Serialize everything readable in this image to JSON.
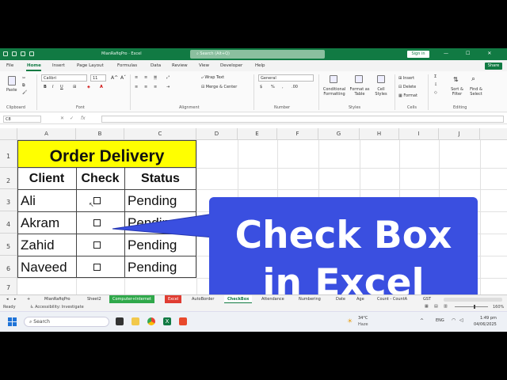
{
  "title_bar": {
    "doc_title": "MianRafiqPro  ·  Excel",
    "search_placeholder": "Search (Alt+Q)",
    "sign_in": "Sign in"
  },
  "menu": [
    "File",
    "Home",
    "Insert",
    "Page Layout",
    "Formulas",
    "Data",
    "Review",
    "View",
    "Developer",
    "Help"
  ],
  "share": "Share",
  "ribbon": {
    "paste": "Paste",
    "font_name": "Calibri",
    "font_size": "11",
    "wrap_text": "Wrap Text",
    "merge_center": "Merge & Center",
    "number_format": "General",
    "conditional_formatting": "Conditional Formatting",
    "format_as_table": "Format as Table",
    "cell_styles": "Cell Styles",
    "insert": "Insert",
    "delete": "Delete",
    "format": "Format",
    "sort_filter": "Sort & Filter",
    "find_select": "Find & Select",
    "groups": {
      "clipboard": "Clipboard",
      "font": "Font",
      "alignment": "Alignment",
      "number": "Number",
      "styles": "Styles",
      "cells": "Cells",
      "editing": "Editing"
    }
  },
  "formula_bar": {
    "name_box": "C8",
    "fx": "fx"
  },
  "columns": [
    "A",
    "B",
    "C",
    "D",
    "E",
    "F",
    "G",
    "H",
    "I",
    "J"
  ],
  "rows": [
    "1",
    "2",
    "3",
    "4",
    "5",
    "6",
    "7"
  ],
  "table": {
    "title": "Order Delivery",
    "headers": [
      "Client",
      "Check",
      "Status"
    ],
    "clients": [
      "Ali",
      "Akram",
      "Zahid",
      "Naveed"
    ],
    "statuses": [
      "Pending",
      "Pending",
      "Pending",
      "Pending"
    ]
  },
  "callout": {
    "line1": "Check Box",
    "line2": "in Excel"
  },
  "sheet_tabs": [
    "MianRafiqPro",
    "Sheet2",
    "Computer+Internet",
    "Excel",
    "AutoBorder",
    "CheckBox",
    "Attendance",
    "Numbering",
    "Date",
    "Age",
    "Count - CountA",
    "GST"
  ],
  "active_tab": "CheckBox",
  "status": {
    "ready": "Ready",
    "accessibility": "Accessibility: Investigate",
    "zoom": "160%"
  },
  "taskbar": {
    "search": "Search",
    "temp": "34°C",
    "weather": "Haze",
    "lang": "ENG",
    "time": "1:49 pm",
    "date": "04/06/2025"
  },
  "colors": {
    "excel_green": "#117a43",
    "title_yellow": "#ffff00",
    "callout_blue": "#3a4fe0"
  }
}
